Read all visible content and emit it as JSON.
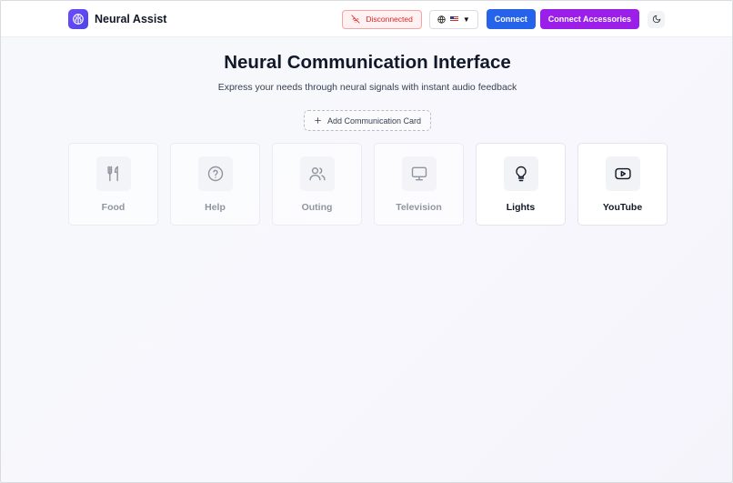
{
  "app": {
    "name": "Neural Assist",
    "logo_icon": "brain-icon",
    "accent": "#5b46f0"
  },
  "header": {
    "status": {
      "label": "Disconnected",
      "icon": "wifi-off-icon",
      "color": "#d62828"
    },
    "language": {
      "icon": "globe-icon",
      "flag": "us-flag",
      "caret": "▼"
    },
    "connect_label": "Connect",
    "connect_color": "#2563eb",
    "accessories_label": "Connect Accessories",
    "accessories_color": "#9b1fe8",
    "theme_icon": "moon-icon"
  },
  "main": {
    "title": "Neural Communication Interface",
    "subtitle": "Express your needs through neural signals with instant audio feedback",
    "add_card_label": "Add Communication Card",
    "cards": [
      {
        "label": "Food",
        "icon": "utensils-icon",
        "active": false
      },
      {
        "label": "Help",
        "icon": "help-circle-icon",
        "active": false
      },
      {
        "label": "Outing",
        "icon": "users-icon",
        "active": false
      },
      {
        "label": "Television",
        "icon": "monitor-icon",
        "active": false
      },
      {
        "label": "Lights",
        "icon": "lightbulb-icon",
        "active": true
      },
      {
        "label": "YouTube",
        "icon": "youtube-icon",
        "active": true
      }
    ]
  }
}
